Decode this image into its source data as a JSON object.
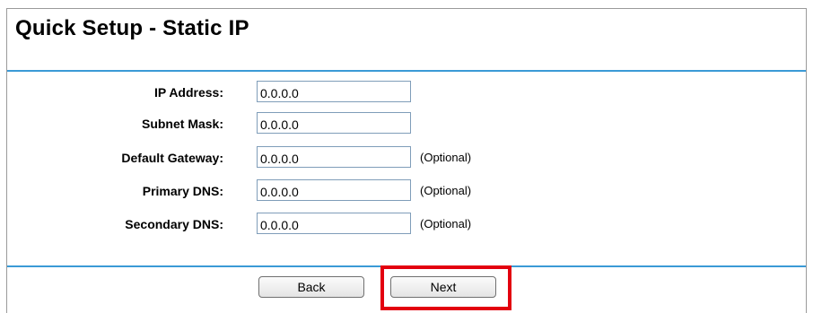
{
  "page": {
    "title": "Quick Setup - Static IP"
  },
  "form": {
    "rows": [
      {
        "label": "IP Address:",
        "value": "0.0.0.0",
        "note": ""
      },
      {
        "label": "Subnet Mask:",
        "value": "0.0.0.0",
        "note": ""
      },
      {
        "label": "Default Gateway:",
        "value": "0.0.0.0",
        "note": "(Optional)"
      },
      {
        "label": "Primary DNS:",
        "value": "0.0.0.0",
        "note": "(Optional)"
      },
      {
        "label": "Secondary DNS:",
        "value": "0.0.0.0",
        "note": "(Optional)"
      }
    ]
  },
  "buttons": {
    "back_label": "Back",
    "next_label": "Next"
  },
  "colors": {
    "rule": "#3b9ad6",
    "highlight": "#e3000f"
  }
}
